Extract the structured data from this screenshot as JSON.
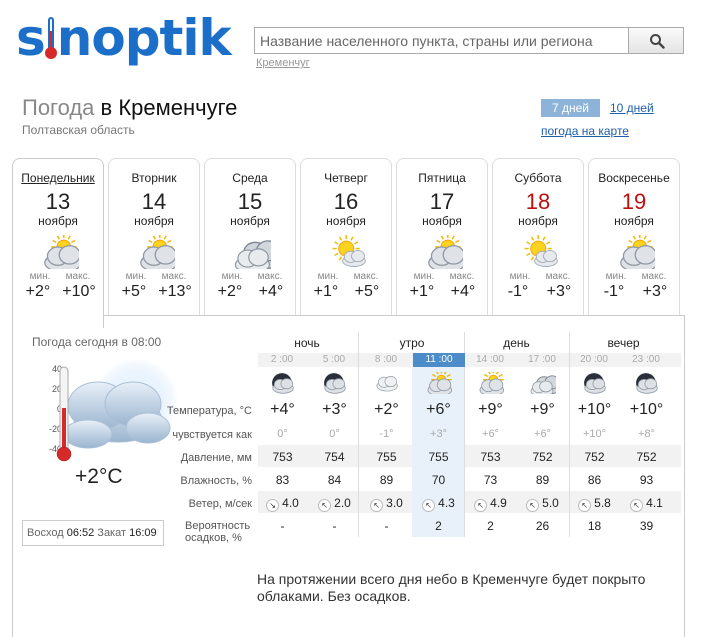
{
  "brand": {
    "logo_left": "s",
    "logo_right": "noptik"
  },
  "search": {
    "placeholder": "Название населенного пункта, страны или региона",
    "hint": "Кременчуг"
  },
  "header": {
    "title_prefix": "Погода",
    "title_city": "в Кременчуге",
    "region": "Полтавская область"
  },
  "periods": {
    "seven_days": "7 дней",
    "ten_days": "10 дней",
    "map_link": "погода на карте"
  },
  "days": [
    {
      "name": "Понедельник",
      "date": "13",
      "month": "ноября",
      "min_label": "мин.",
      "max_label": "макс.",
      "min": "+2°",
      "max": "+10°",
      "weekend": false,
      "icon": "partly-cloudy-icon"
    },
    {
      "name": "Вторник",
      "date": "14",
      "month": "ноября",
      "min_label": "мин.",
      "max_label": "макс.",
      "min": "+5°",
      "max": "+13°",
      "weekend": false,
      "icon": "partly-cloudy-icon"
    },
    {
      "name": "Среда",
      "date": "15",
      "month": "ноября",
      "min_label": "мин.",
      "max_label": "макс.",
      "min": "+2°",
      "max": "+4°",
      "weekend": false,
      "icon": "cloudy-icon"
    },
    {
      "name": "Четверг",
      "date": "16",
      "month": "ноября",
      "min_label": "мин.",
      "max_label": "макс.",
      "min": "+1°",
      "max": "+5°",
      "weekend": false,
      "icon": "sun-cloud-icon"
    },
    {
      "name": "Пятница",
      "date": "17",
      "month": "ноября",
      "min_label": "мин.",
      "max_label": "макс.",
      "min": "+1°",
      "max": "+4°",
      "weekend": false,
      "icon": "partly-cloudy-icon"
    },
    {
      "name": "Суббота",
      "date": "18",
      "month": "ноября",
      "min_label": "мин.",
      "max_label": "макс.",
      "min": "-1°",
      "max": "+3°",
      "weekend": true,
      "icon": "sun-cloud-icon"
    },
    {
      "name": "Воскресенье",
      "date": "19",
      "month": "ноября",
      "min_label": "мин.",
      "max_label": "макс.",
      "min": "-1°",
      "max": "+3°",
      "weekend": true,
      "icon": "partly-cloudy-icon"
    }
  ],
  "current": {
    "label": "Погода сегодня в 08:00",
    "temp": "+2°C",
    "scale": [
      "40",
      "20",
      "0",
      "-20",
      "-40"
    ],
    "sunrise_label": "Восход",
    "sunrise": "06:52",
    "sunset_label": "Закат",
    "sunset": "16:09"
  },
  "parts": [
    "ночь",
    "утро",
    "день",
    "вечер"
  ],
  "times": [
    "2 :00",
    "5 :00",
    "8 :00",
    "11 :00",
    "14 :00",
    "17 :00",
    "20 :00",
    "23 :00"
  ],
  "row_labels": {
    "temp": "Температура, °С",
    "feel": "чувствуется как",
    "pressure": "Давление, мм",
    "humidity": "Влажность, %",
    "wind": "Ветер, м/сек",
    "precip": "Вероятность осадков, %"
  },
  "hourly": {
    "icons": [
      "night-cloudy-icon",
      "night-cloudy-icon",
      "cloud-icon",
      "partly-cloudy-icon",
      "partly-cloudy-icon",
      "cloudy-icon",
      "night-cloudy-icon",
      "night-cloudy-icon"
    ],
    "temp": [
      "+4°",
      "+3°",
      "+2°",
      "+6°",
      "+9°",
      "+9°",
      "+10°",
      "+10°"
    ],
    "feel": [
      "0°",
      "0°",
      "-1°",
      "+3°",
      "+6°",
      "+6°",
      "+10°",
      "+8°"
    ],
    "pressure": [
      "753",
      "754",
      "755",
      "755",
      "753",
      "752",
      "752",
      "752"
    ],
    "humidity": [
      "83",
      "84",
      "89",
      "70",
      "73",
      "89",
      "86",
      "93"
    ],
    "wind_dir": [
      "↘",
      "↖",
      "↖",
      "↖",
      "↖",
      "↖",
      "↖",
      "↖"
    ],
    "wind": [
      "4.0",
      "2.0",
      "3.0",
      "4.3",
      "4.9",
      "5.0",
      "5.8",
      "4.1"
    ],
    "precip": [
      "-",
      "-",
      "-",
      "2",
      "2",
      "26",
      "18",
      "39"
    ]
  },
  "description": "На протяжении всего дня небо в Кременчуге будет покрыто облаками. Без осадков.",
  "colors": {
    "brand": "#1c6fc8",
    "weekend": "#bb1111",
    "highlight": "#e8f1fa",
    "current_time": "#4c8dc9"
  }
}
